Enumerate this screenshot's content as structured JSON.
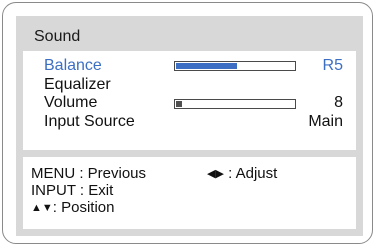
{
  "menu": {
    "title": "Sound",
    "rows": [
      {
        "label": "Balance",
        "value": "R5",
        "selected": true,
        "level": 0.52
      },
      {
        "label": "Equalizer",
        "value": ""
      },
      {
        "label": "Volume",
        "value": "8",
        "level": 0.05
      },
      {
        "label": "Input Source",
        "value": "Main"
      }
    ]
  },
  "footer": {
    "menu_hint": "MENU : Previous",
    "adjust_hint": ": Adjust",
    "input_hint": "INPUT : Exit",
    "position_hint": ": Position",
    "adjust_icon_left": "◀",
    "adjust_icon_right": "▶",
    "position_icon_up": "▲",
    "position_icon_down": "▼"
  },
  "colors": {
    "accent": "#3c6fc4",
    "panel_bg": "#ffffff",
    "frame_gray": "#d8d8d8",
    "text": "#111111"
  }
}
